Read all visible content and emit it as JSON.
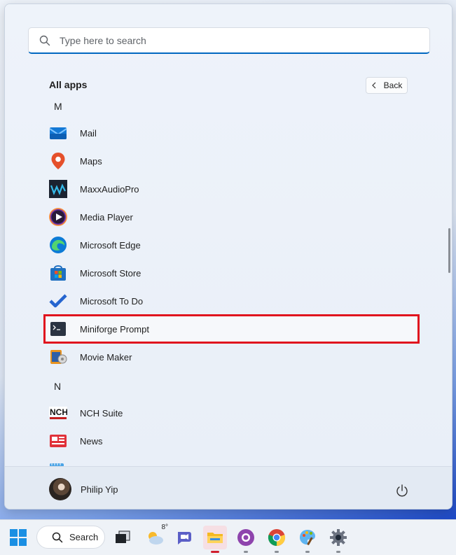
{
  "search": {
    "placeholder": "Type here to search"
  },
  "all_apps": {
    "title": "All apps",
    "back_label": "Back"
  },
  "groups": [
    {
      "letter": "M"
    },
    {
      "letter": "N"
    }
  ],
  "apps": [
    {
      "label": "Mail",
      "icon": "mail-icon"
    },
    {
      "label": "Maps",
      "icon": "maps-icon"
    },
    {
      "label": "MaxxAudioPro",
      "icon": "maxxaudio-icon"
    },
    {
      "label": "Media Player",
      "icon": "media-player-icon"
    },
    {
      "label": "Microsoft Edge",
      "icon": "edge-icon"
    },
    {
      "label": "Microsoft Store",
      "icon": "store-icon"
    },
    {
      "label": "Microsoft To Do",
      "icon": "todo-icon"
    },
    {
      "label": "Miniforge Prompt",
      "icon": "terminal-icon"
    },
    {
      "label": "Movie Maker",
      "icon": "movie-maker-icon"
    },
    {
      "label": "NCH Suite",
      "icon": "nch-icon"
    },
    {
      "label": "News",
      "icon": "news-icon"
    }
  ],
  "user": {
    "name": "Philip Yip"
  },
  "taskbar": {
    "search_label": "Search",
    "weather_temp": "8°"
  },
  "colors": {
    "accent": "#0067c0",
    "highlight": "#e0141e"
  }
}
